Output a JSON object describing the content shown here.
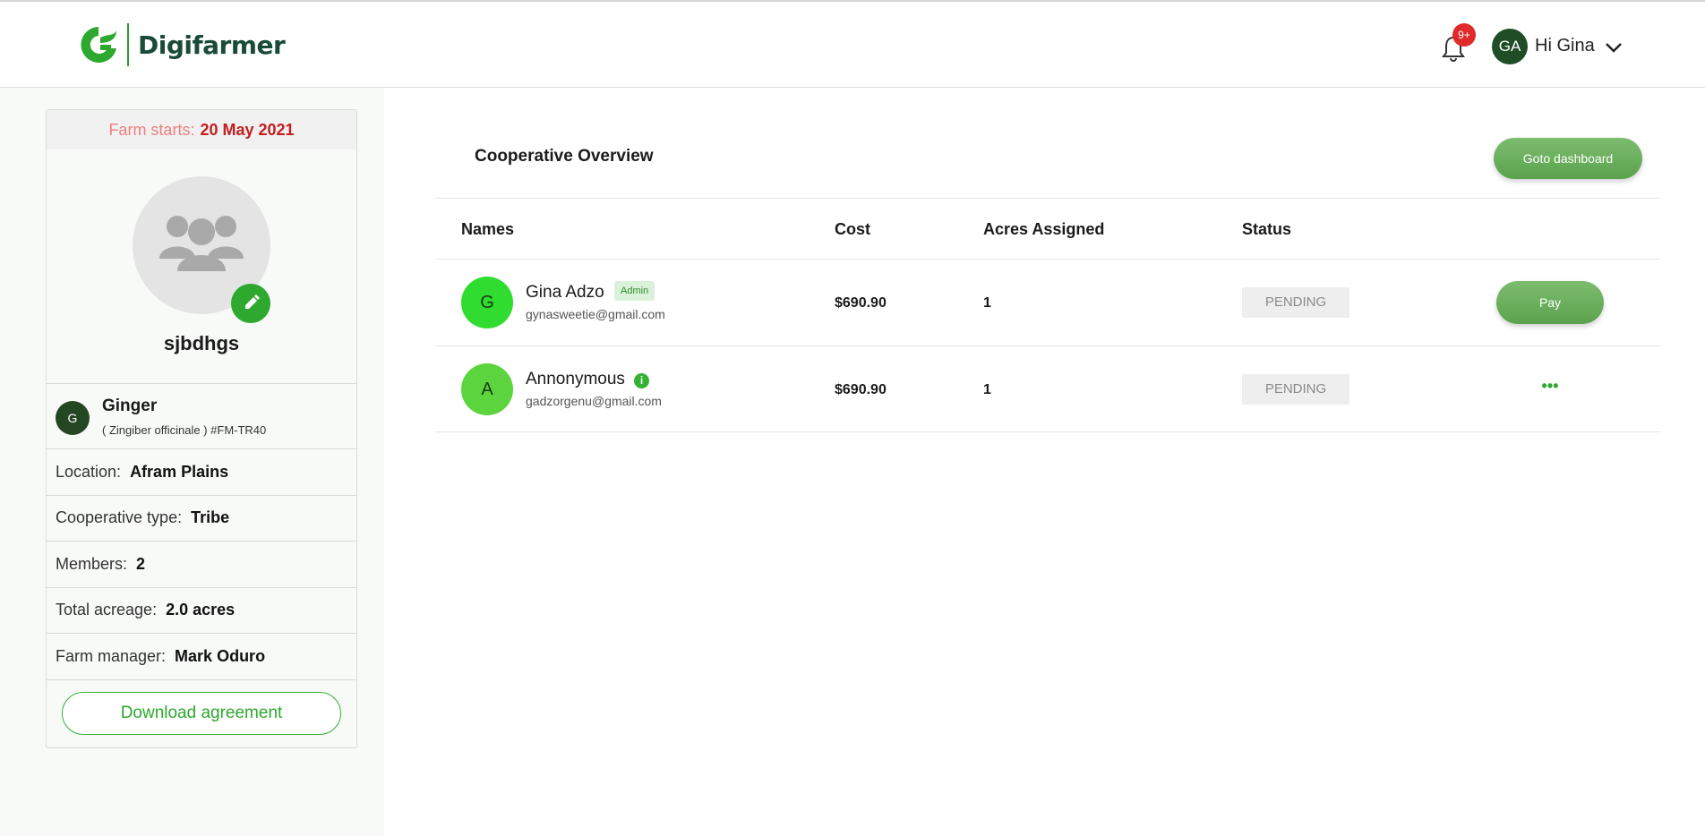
{
  "header": {
    "brand": "Digifarmer",
    "notification_count": "9+",
    "user_initials": "GA",
    "greeting": "Hi Gina"
  },
  "sidebar": {
    "farm_start_label": "Farm starts:",
    "farm_start_date": "20 May 2021",
    "profile_name": "sjbdhgs",
    "crop": {
      "initial": "G",
      "name": "Ginger",
      "subtitle": "( Zingiber officinale ) #FM-TR40"
    },
    "details": [
      {
        "label": "Location:",
        "value": "Afram Plains"
      },
      {
        "label": "Cooperative type:",
        "value": "Tribe"
      },
      {
        "label": "Members:",
        "value": "2"
      },
      {
        "label": "Total acreage:",
        "value": "2.0 acres"
      },
      {
        "label": "Farm manager:",
        "value": "Mark Oduro"
      }
    ],
    "download_label": "Download agreement"
  },
  "main": {
    "title": "Cooperative Overview",
    "goto_label": "Goto dashboard",
    "columns": [
      "Names",
      "Cost",
      "Acres Assigned",
      "Status"
    ],
    "rows": [
      {
        "initial": "G",
        "name": "Gina Adzo",
        "badge": "Admin",
        "email": "gynasweetie@gmail.com",
        "cost": "$690.90",
        "acres": "1",
        "status": "PENDING",
        "action": "Pay",
        "avatar_color": "#2fdc2f"
      },
      {
        "initial": "A",
        "name": "Annonymous",
        "badge": "i",
        "email": "gadzorgenu@gmail.com",
        "cost": "$690.90",
        "acres": "1",
        "status": "PENDING",
        "action": "•••",
        "avatar_color": "#5cd43e"
      }
    ]
  },
  "colors": {
    "brand_green": "#2ea82e",
    "brand_dark": "#1a4a38",
    "pending_bg": "#eeeeee",
    "farm_date": "#c41e1e"
  }
}
